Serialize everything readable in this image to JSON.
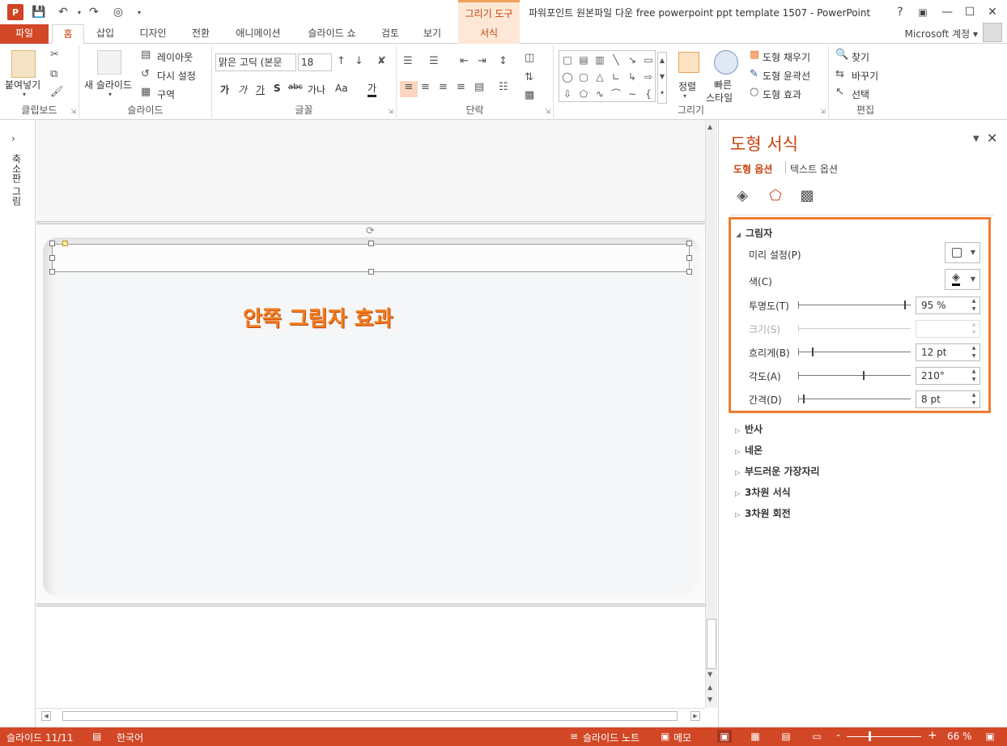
{
  "window": {
    "title": "파워포인트 원본파일 다운 free powerpoint ppt template 1507 - PowerPoint",
    "app_icon": "P",
    "context_tab_group": "그리기 도구",
    "help": "?",
    "account": "Microsoft 계정"
  },
  "tabs": {
    "file": "파일",
    "home": "홈",
    "insert": "삽입",
    "design": "디자인",
    "transitions": "전환",
    "animations": "애니메이션",
    "slideshow": "슬라이드 쇼",
    "review": "검토",
    "view": "보기",
    "format": "서식"
  },
  "ribbon": {
    "clipboard": {
      "label": "클립보드",
      "paste": "붙여넣기"
    },
    "slides": {
      "label": "슬라이드",
      "new_slide": "새 슬라이드",
      "layout": "레이아웃",
      "reset": "다시 설정",
      "section": "구역"
    },
    "font": {
      "label": "글꼴",
      "font_name": "맑은 고딕 (본문",
      "font_size": "18",
      "bold": "가",
      "italic": "가",
      "underline": "가",
      "shadow": "S",
      "strike": "abc",
      "spacing": "가나",
      "case": "Aa",
      "color": "가"
    },
    "paragraph": {
      "label": "단락"
    },
    "drawing": {
      "label": "그리기",
      "arrange": "정렬",
      "quick_styles_1": "빠른",
      "quick_styles_2": "스타일",
      "fill": "도형 채우기",
      "outline": "도형 윤곽선",
      "effects": "도형 효과"
    },
    "editing": {
      "label": "편집",
      "find": "찾기",
      "replace": "바꾸기",
      "select": "선택"
    }
  },
  "left_pane": {
    "label": "축소판 그림"
  },
  "slide": {
    "text": "안쪽 그림자 효과"
  },
  "format_pane": {
    "title": "도형 서식",
    "options_shape": "도형 옵션",
    "options_text": "텍스트 옵션",
    "shadow": {
      "title": "그림자",
      "preset_label": "미리 설정(P)",
      "color_label": "색(C)",
      "transparency_label": "투명도(T)",
      "transparency_value": "95 %",
      "transparency_level": 0.95,
      "size_label": "크기(S)",
      "size_value": "",
      "blur_label": "흐리게(B)",
      "blur_value": "12 pt",
      "blur_level": 0.12,
      "angle_label": "각도(A)",
      "angle_value": "210°",
      "angle_level": 0.58,
      "distance_label": "간격(D)",
      "distance_value": "8 pt",
      "distance_level": 0.04
    },
    "sections": [
      "반사",
      "네온",
      "부드러운 가장자리",
      "3차원 서식",
      "3차원 회전"
    ]
  },
  "status": {
    "slide": "슬라이드 11/11",
    "language": "한국어",
    "notes": "슬라이드 노트",
    "comments": "메모",
    "zoom": "66 %",
    "minus": "-",
    "plus": "+"
  },
  "colors": {
    "accent": "#d24726",
    "highlight": "#ed7d31",
    "slide_text": "#f07d1c"
  }
}
